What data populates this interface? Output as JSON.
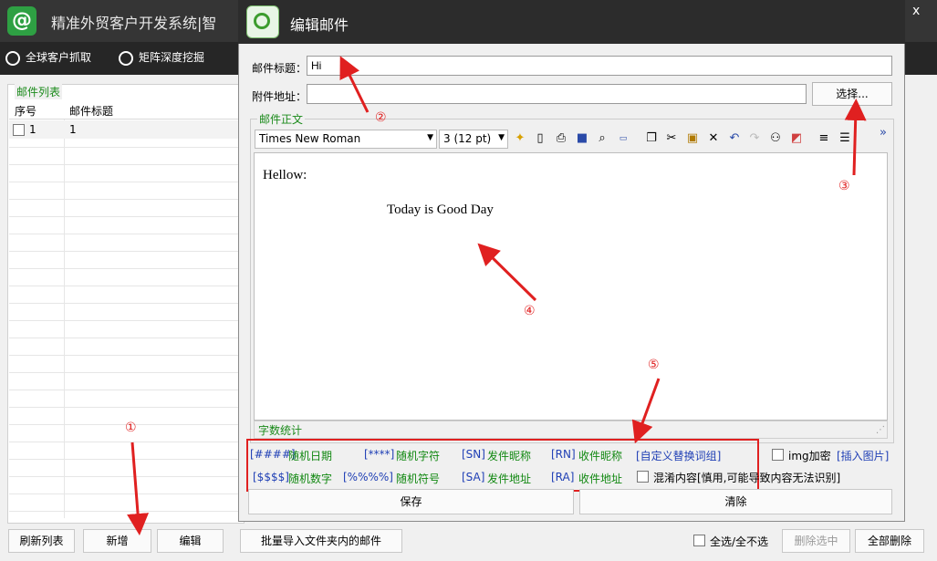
{
  "app": {
    "logo_glyph": "@",
    "title": "精准外贸客户开发系统|智",
    "minimize_glyph": "_",
    "close_glyph": "x"
  },
  "toolbar": {
    "items": [
      {
        "label": "全球客户抓取",
        "icon": "globe-icon"
      },
      {
        "label": "矩阵深度挖掘",
        "icon": "search-icon"
      }
    ]
  },
  "mail_list": {
    "group_label": "邮件列表",
    "columns": [
      "序号",
      "邮件标题"
    ],
    "rows": [
      {
        "seq": "1",
        "subject": "1"
      }
    ]
  },
  "bottom_bar": {
    "refresh": "刷新列表",
    "add": "新增",
    "edit": "编辑",
    "batch_import": "批量导入文件夹内的邮件",
    "select_all": "全选/全不选",
    "delete_selected": "删除选中",
    "delete_all": "全部删除"
  },
  "dialog": {
    "title": "编辑邮件",
    "subject_label": "邮件标题：",
    "subject_value": "Hi",
    "attachment_label": "附件地址：",
    "attachment_value": "",
    "choose_button": "选择...",
    "body_group_label": "邮件正文",
    "font_name": "Times New Roman",
    "font_size": "3 (12 pt)",
    "toolbar_more": "»",
    "body_lines": [
      "Hellow:",
      "Today is Good Day"
    ],
    "word_count_label": "字数统计",
    "variables": [
      {
        "token": "[####]",
        "desc": "随机日期"
      },
      {
        "token": "[****]",
        "desc": "随机字符"
      },
      {
        "token": "[SN]",
        "desc": "发件昵称"
      },
      {
        "token": "[RN]",
        "desc": "收件昵称"
      },
      {
        "token": "[$$$$]",
        "desc": "随机数字"
      },
      {
        "token": "[%%%%]",
        "desc": "随机符号"
      },
      {
        "token": "[SA]",
        "desc": "发件地址"
      },
      {
        "token": "[RA]",
        "desc": "收件地址"
      }
    ],
    "custom_replace": "[自定义替换词组]",
    "img_encrypt_label": "img加密",
    "insert_image": "[插入图片]",
    "mix_content_label": "混淆内容[慎用,可能导致内容无法识别]",
    "save_button": "保存",
    "clear_button": "清除"
  },
  "annotations": [
    "①",
    "②",
    "③",
    "④",
    "⑤"
  ],
  "colors": {
    "title_bar": "#353535",
    "toolbar": "#262626",
    "group_label_green": "#1a8a1a",
    "token_blue": "#1f3fb5",
    "annotation_red": "#e02020"
  }
}
